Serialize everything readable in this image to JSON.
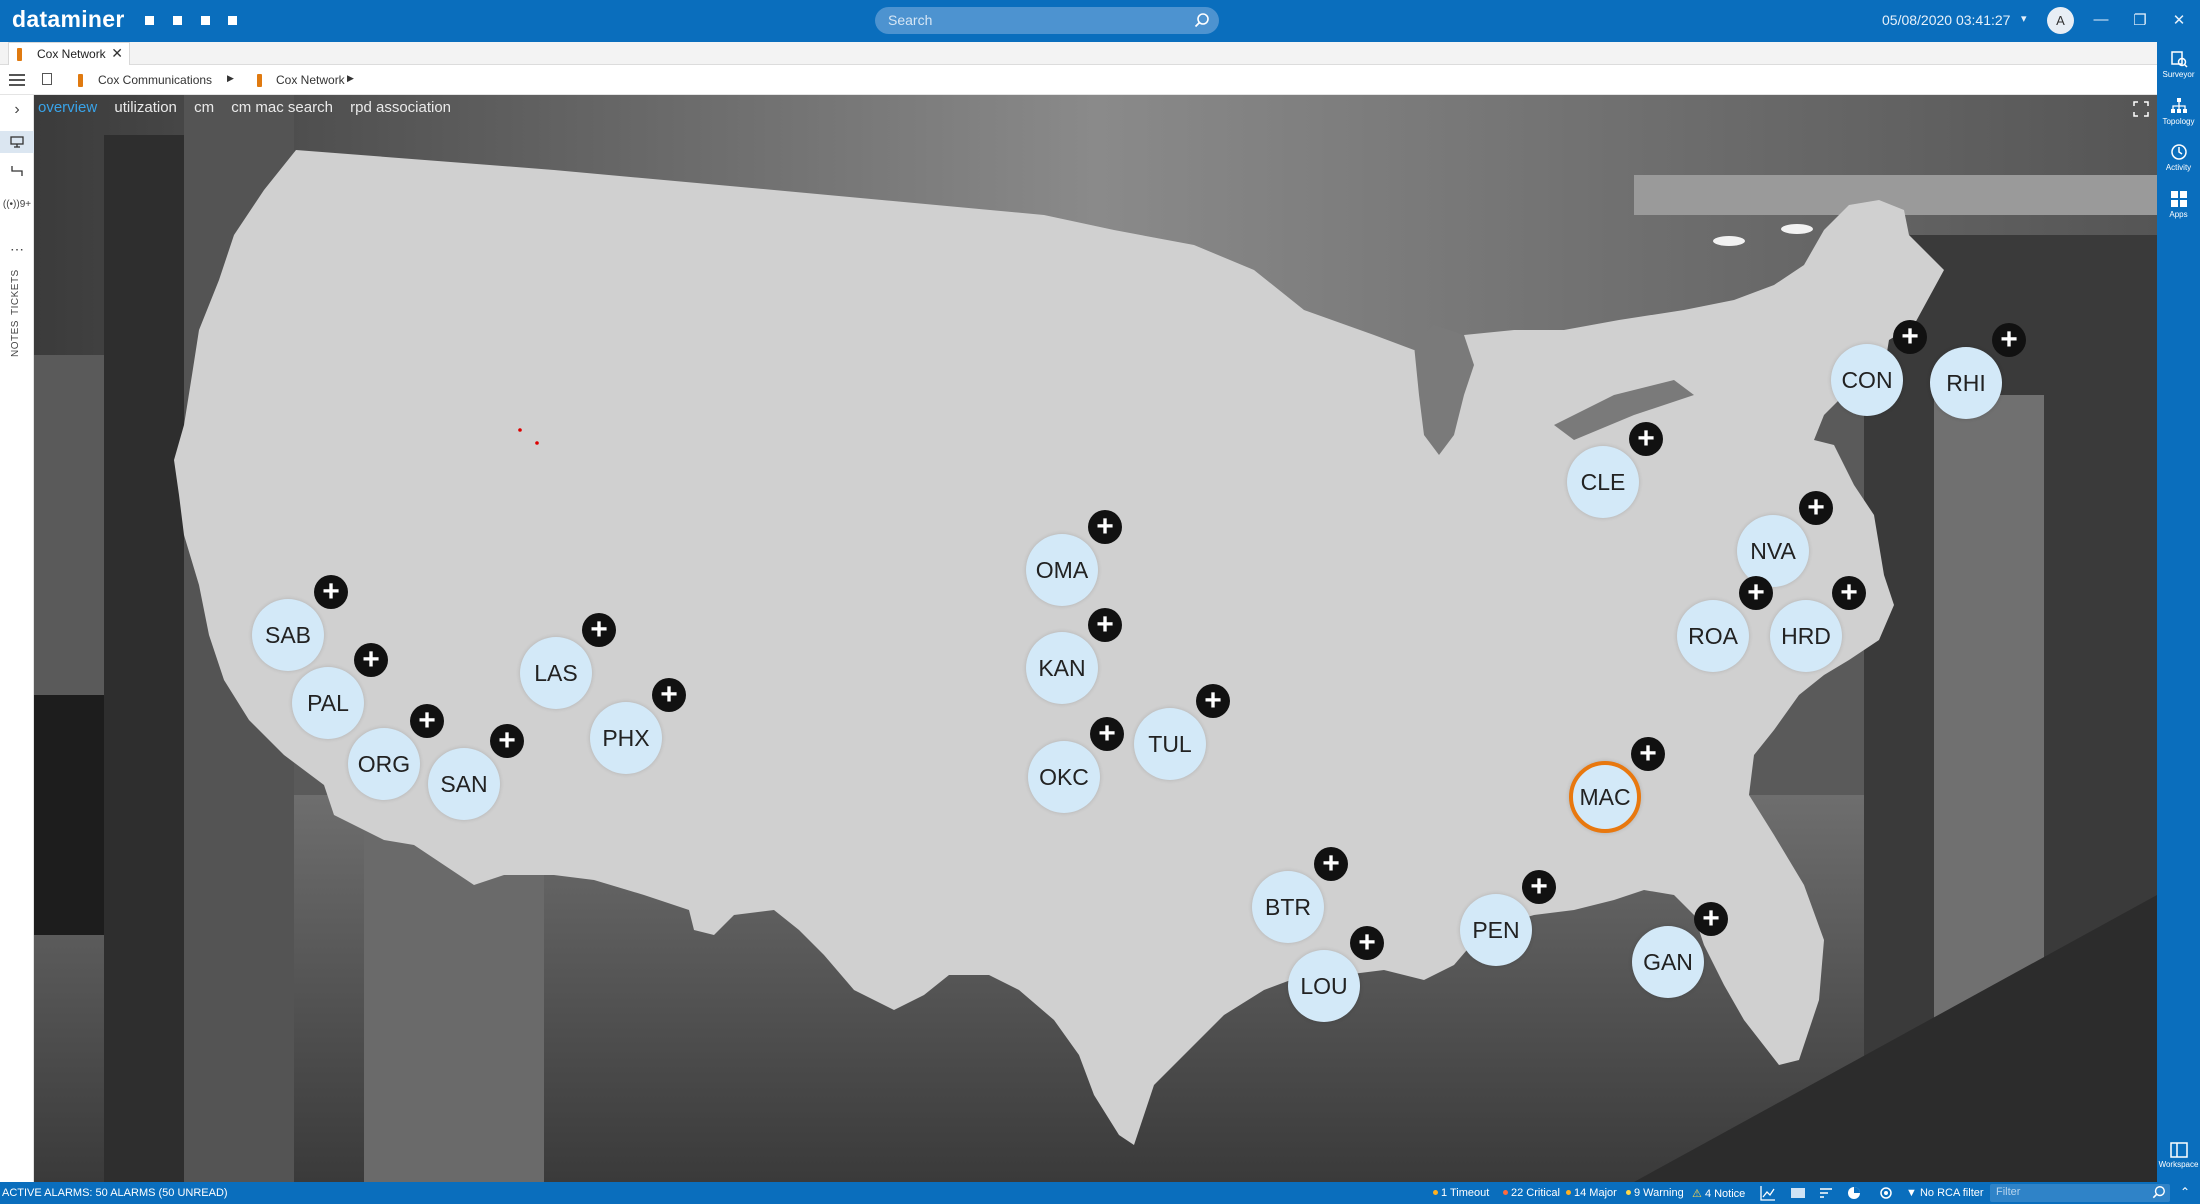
{
  "app": {
    "logo": "dataminer",
    "search_placeholder": "Search",
    "datetime": "05/08/2020 03:41:27",
    "user_initial": "A"
  },
  "tabs": [
    {
      "label": "Cox Network"
    }
  ],
  "breadcrumb": [
    {
      "label": "Cox Communications"
    },
    {
      "label": "Cox Network"
    }
  ],
  "left_rail": {
    "tickets_label": "TICKETS",
    "notes_label": "NOTES",
    "badge_text": "9+"
  },
  "right_rail": [
    {
      "label": "Surveyor",
      "icon": "surveyor-icon"
    },
    {
      "label": "Topology",
      "icon": "topology-icon"
    },
    {
      "label": "Activity",
      "icon": "activity-icon"
    },
    {
      "label": "Apps",
      "icon": "apps-icon"
    },
    {
      "label": "Workspace",
      "icon": "workspace-icon"
    }
  ],
  "view_tabs": [
    {
      "label": "overview",
      "active": true
    },
    {
      "label": "utilization"
    },
    {
      "label": "cm"
    },
    {
      "label": "cm mac search"
    },
    {
      "label": "rpd association"
    }
  ],
  "sites": [
    {
      "code": "SAB"
    },
    {
      "code": "PAL"
    },
    {
      "code": "ORG"
    },
    {
      "code": "SAN"
    },
    {
      "code": "LAS"
    },
    {
      "code": "PHX"
    },
    {
      "code": "OMA"
    },
    {
      "code": "KAN"
    },
    {
      "code": "OKC"
    },
    {
      "code": "TUL"
    },
    {
      "code": "BTR"
    },
    {
      "code": "LOU"
    },
    {
      "code": "PEN"
    },
    {
      "code": "MAC",
      "selected": true
    },
    {
      "code": "GAN"
    },
    {
      "code": "CLE"
    },
    {
      "code": "CON"
    },
    {
      "code": "RHI"
    },
    {
      "code": "NVA"
    },
    {
      "code": "ROA"
    },
    {
      "code": "HRD"
    }
  ],
  "plus_symbol": "+",
  "status_bar": {
    "active_alarms": "ACTIVE ALARMS: 50 ALARMS (50 UNREAD)",
    "timeout": "1 Timeout",
    "critical": "22 Critical",
    "major": "14 Major",
    "warning": "9 Warning",
    "notice": "4 Notice",
    "rca_filter": "No RCA filter",
    "filter_placeholder": "Filter",
    "colors": {
      "timeout": "#ffb020",
      "critical": "#ff6a3d",
      "major": "#ffb020",
      "warning": "#ffd84a",
      "notice": "#ffffff"
    }
  },
  "colors": {
    "accent": "#0a6ebd",
    "site_fill": "#d3e9f8",
    "selected_ring": "#e8780f",
    "map_fill": "#d0d0d0"
  }
}
